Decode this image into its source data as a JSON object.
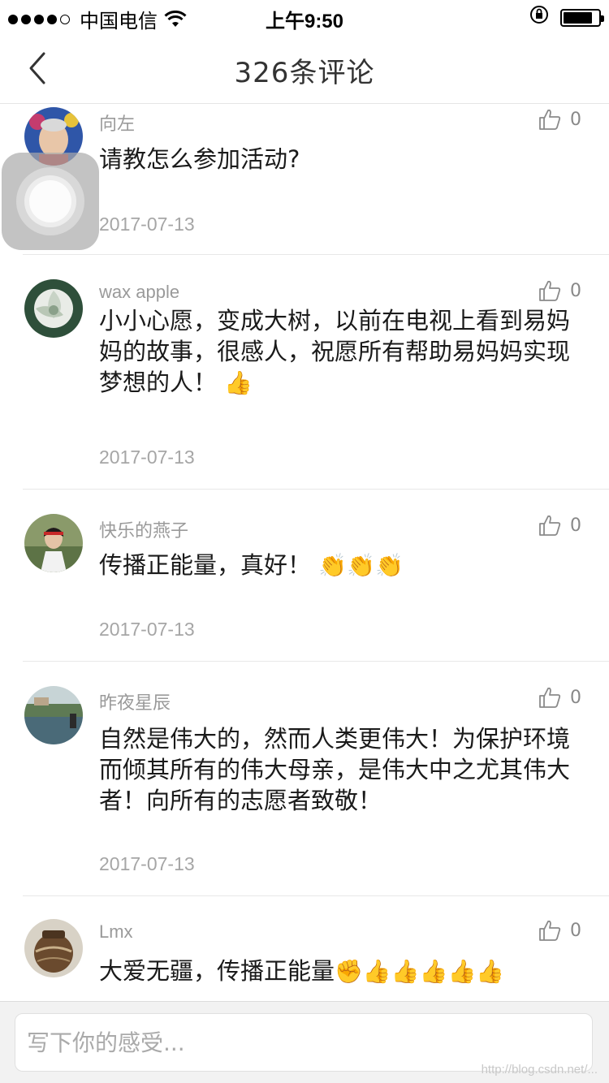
{
  "status_bar": {
    "carrier": "中国电信",
    "time": "上午9:50",
    "battery_level": 0.85
  },
  "nav": {
    "title": "326条评论"
  },
  "comments": [
    {
      "name": "向左",
      "text": "请教怎么参加活动?",
      "emojis": "",
      "date": "2017-07-13",
      "likes": "0"
    },
    {
      "name": "wax apple",
      "text": "小小心愿，变成大树，以前在电视上看到易妈妈的故事，很感人，祝愿所有帮助易妈妈实现梦想的人！",
      "emojis": "👍",
      "date": "2017-07-13",
      "likes": "0"
    },
    {
      "name": "快乐的燕子",
      "text": "传播正能量，真好！",
      "emojis": "👏👏👏",
      "date": "2017-07-13",
      "likes": "0"
    },
    {
      "name": "昨夜星辰",
      "text": "自然是伟大的，然而人类更伟大！为保护环境而倾其所有的伟大母亲，是伟大中之尤其伟大者！向所有的志愿者致敬！",
      "emojis": "",
      "date": "2017-07-13",
      "likes": "0"
    },
    {
      "name": "Lmx",
      "text": "大爱无疆，传播正能量",
      "emojis": "✊👍👍👍👍👍",
      "date": "",
      "likes": "0"
    }
  ],
  "input": {
    "placeholder": "写下你的感受..."
  },
  "watermark": "http://blog.csdn.net/..."
}
